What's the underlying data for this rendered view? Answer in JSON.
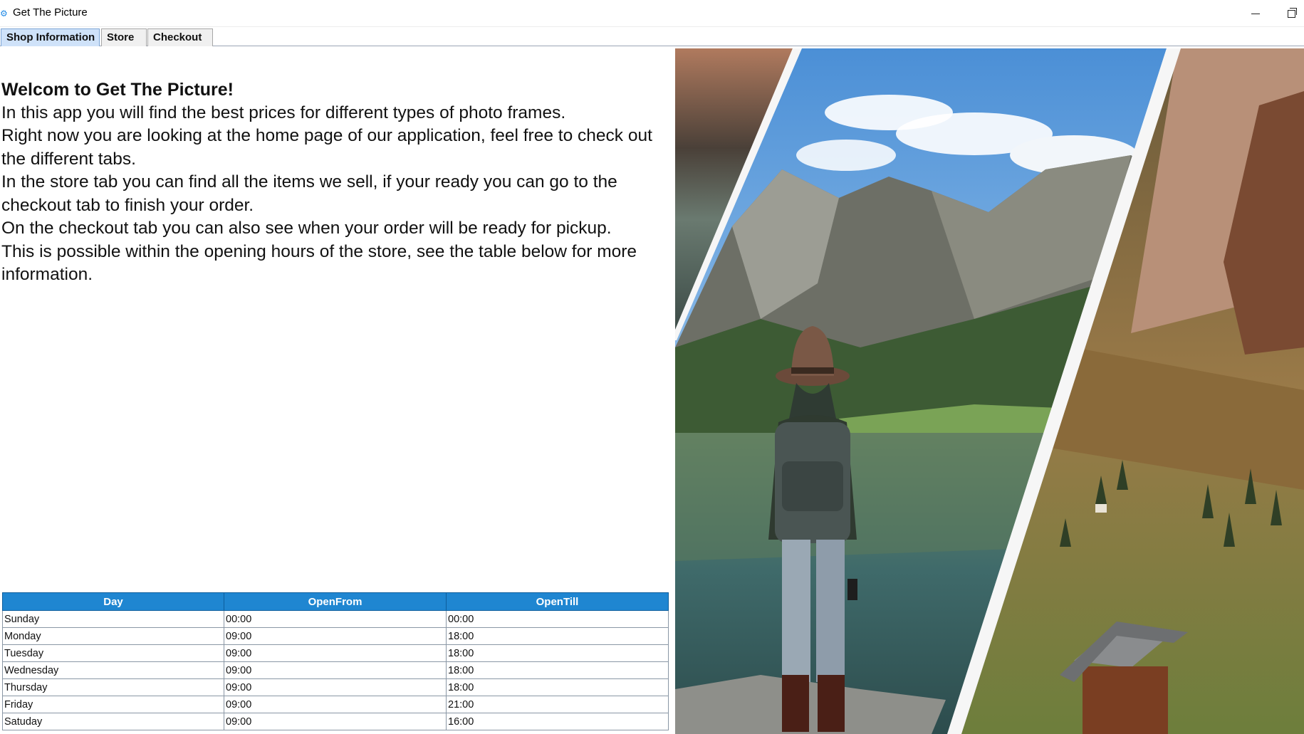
{
  "window": {
    "title": "Get The Picture",
    "app_icon": "gear-icon"
  },
  "tabs": [
    {
      "label": "Shop Information",
      "active": true
    },
    {
      "label": "Store",
      "active": false
    },
    {
      "label": "Checkout",
      "active": false
    }
  ],
  "intro": {
    "heading": "Welcom to Get The Picture!",
    "paragraphs": [
      "In this app you will find the best prices for different types of photo frames.",
      "Right now you are looking at the home page of our application, feel free to check out the different tabs.",
      "In the store tab you can find all the items we sell, if your ready you can go to the checkout tab to finish your order.",
      "On the checkout tab you can also see when your order will be ready for pickup.",
      "This is possible within the opening hours of the store, see the table below for more information."
    ]
  },
  "hours_table": {
    "columns": [
      "Day",
      "OpenFrom",
      "OpenTill"
    ],
    "rows": [
      [
        "Sunday",
        "00:00",
        "00:00"
      ],
      [
        "Monday",
        "09:00",
        "18:00"
      ],
      [
        "Tuesday",
        "09:00",
        "18:00"
      ],
      [
        "Wednesday",
        "09:00",
        "18:00"
      ],
      [
        "Thursday",
        "09:00",
        "18:00"
      ],
      [
        "Friday",
        "09:00",
        "21:00"
      ],
      [
        "Satuday",
        "09:00",
        "16:00"
      ]
    ]
  },
  "colors": {
    "table_header": "#1f86d1",
    "active_tab": "#cfe2f9"
  }
}
